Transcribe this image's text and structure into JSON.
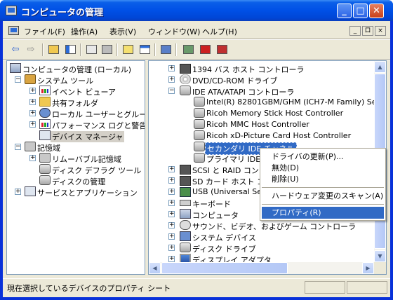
{
  "window": {
    "title": "コンピュータの管理"
  },
  "menu": {
    "items": [
      "ファイル(F)",
      "操作(A)",
      "表示(V)",
      "ウィンドウ(W)",
      "ヘルプ(H)"
    ],
    "mdi_buttons": [
      "_",
      "ロ",
      "×"
    ]
  },
  "toolbar": {
    "buttons": [
      "back-arrow-icon",
      "forward-arrow-icon",
      "up-folder-icon",
      "show-hide-tree-icon",
      "properties-icon",
      "print-icon",
      "help-icon",
      "view-icon",
      "scan-hardware-icon",
      "update-driver-icon",
      "uninstall-icon",
      "disable-icon"
    ]
  },
  "left_tree": {
    "root": "コンピュータの管理 (ローカル)",
    "system_tools": "システム ツール",
    "event_viewer": "イベント ビューア",
    "shared_folders": "共有フォルダ",
    "local_users": "ローカル ユーザーとグループ",
    "perf_logs": "パフォーマンス ログと警告",
    "device_manager": "デバイス マネージャ",
    "storage": "記憶域",
    "removable_storage": "リムーバブル記憶域",
    "disk_defrag": "ディスク デフラグ ツール",
    "disk_mgmt": "ディスクの管理",
    "services_apps": "サービスとアプリケーション"
  },
  "right_tree": {
    "ieee1394": "1394 バス ホスト コントローラ",
    "dvd": "DVD/CD-ROM ドライブ",
    "ide_atapi": "IDE ATA/ATAPI コントローラ",
    "intel": "Intel(R) 82801GBM/GHM (ICH7-M Family) Se",
    "ricoh_ms": "Ricoh Memory Stick Host Controller",
    "ricoh_mmc": "Ricoh MMC Host Controller",
    "ricoh_xd": "Ricoh xD-Picture Card Host Controller",
    "secondary_ide": "セカンダリ IDE チャネル",
    "primary_ide": "プライマリ IDE チ",
    "scsi": "SCSI と RAID コント",
    "sd": "SD カード ホスト コ",
    "usb": "USB (Universal Se",
    "keyboard": "キーボード",
    "computer": "コンピュータ",
    "sound": "サウンド、ビデオ、およびゲーム コントローラ",
    "system_devices": "システム デバイス",
    "disk_drives": "ディスク ドライブ",
    "display": "ディスプレイ アダプタ"
  },
  "context_menu": {
    "update_driver": "ドライバの更新(P)...",
    "disable": "無効(D)",
    "uninstall": "削除(U)",
    "scan": "ハードウェア変更のスキャン(A)",
    "properties": "プロパティ(R)"
  },
  "status": {
    "text": "現在選択しているデバイスのプロパティ シート"
  },
  "colors": {
    "titlebar": "#0050e6",
    "selection": "#316ac5",
    "face": "#ece9d8"
  }
}
